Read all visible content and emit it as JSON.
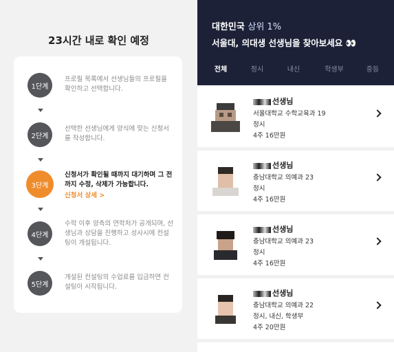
{
  "left": {
    "title": "23시간 내로 확인 예정",
    "steps": [
      {
        "label": "1단계",
        "text": "프로필 목록에서 선생님들의 프로필을 확인하고 선택합니다."
      },
      {
        "label": "2단계",
        "text": "선택한 선생님에게 양식에 맞는 신청서를 작성합니다."
      },
      {
        "label": "3단계",
        "text": "신청서가 확인될 때까지 대기하며 그 전까지 수정, 삭제가 가능합니다.",
        "link": "신청서 상세 >"
      },
      {
        "label": "4단계",
        "text": "수락 이후 양측의 연락처가 공개되며, 선생님과 상담을 진행하고 성사시에 컨설팅이 개설됩니다."
      },
      {
        "label": "5단계",
        "text": "개설된 컨설팅의 수업료를 입금하면 컨설팅이 시작됩니다."
      }
    ],
    "accent_color": "#ef8c2c"
  },
  "right": {
    "hero": {
      "line1_a": "대한민국 ",
      "line1_b": "상위 1%",
      "line2": "서울대, 의대생 선생님을 찾아보세요 👀"
    },
    "tabs": [
      "전체",
      "정시",
      "내신",
      "학생부",
      "중등"
    ],
    "active_tab": "전체",
    "teachers": [
      {
        "name": "선생님",
        "school": "서울대학교 수학교육과 19",
        "type": "정시",
        "price": "4주 16만원"
      },
      {
        "name": "선생님",
        "school": "충남대학교 의예과 23",
        "type": "정시",
        "price": "4주 16만원"
      },
      {
        "name": "선생님",
        "school": "충남대학교 의예과 23",
        "type": "정시",
        "price": "4주 16만원"
      },
      {
        "name": "선생님",
        "school": "충남대학교 의예과 22",
        "type": "정시, 내신, 학생부",
        "price": "4주 20만원"
      }
    ]
  }
}
